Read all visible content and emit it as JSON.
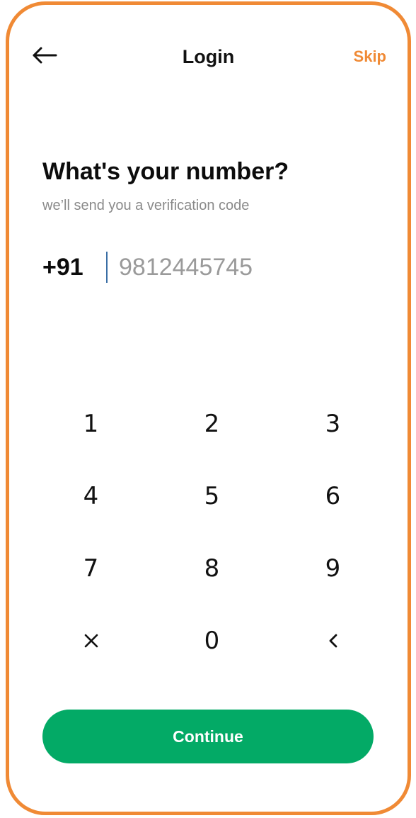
{
  "header": {
    "title": "Login",
    "skip_label": "Skip",
    "back_icon": "arrow-left-icon"
  },
  "main": {
    "heading": "What's your number?",
    "subheading": "we’ll send you a verification code",
    "country_code": "+91",
    "phone_value": "9812445745",
    "phone_placeholder": "9812445745"
  },
  "keypad": {
    "keys": [
      "1",
      "2",
      "3",
      "4",
      "5",
      "6",
      "7",
      "8",
      "9",
      "×",
      "0",
      "<"
    ],
    "clear_icon": "close-icon",
    "backspace_icon": "chevron-left-icon"
  },
  "footer": {
    "continue_label": "Continue"
  },
  "colors": {
    "accent": "#F08A35",
    "primary_button": "#03AA66",
    "text": "#111111",
    "muted_text": "#8a8a8a"
  }
}
